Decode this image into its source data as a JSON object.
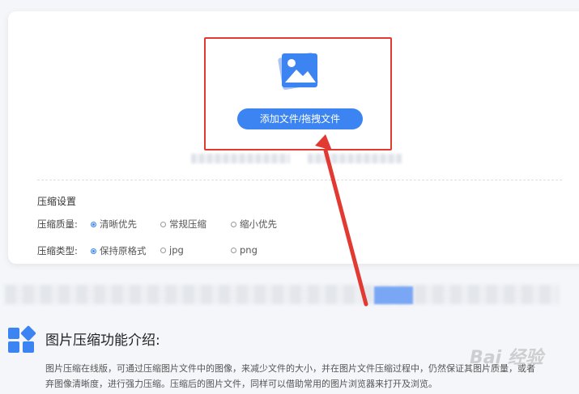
{
  "upload": {
    "add_button_label": "添加文件/拖拽文件"
  },
  "settings": {
    "title": "压缩设置",
    "quality": {
      "label": "压缩质量:",
      "options": [
        "清晰优先",
        "常规压缩",
        "缩小优先"
      ],
      "selected": "清晰优先"
    },
    "type": {
      "label": "压缩类型:",
      "options": [
        "保持原格式",
        "jpg",
        "png"
      ],
      "selected": "保持原格式"
    }
  },
  "intro": {
    "title": "图片压缩功能介绍:",
    "line1": "图片压缩在线版，可通过压缩图片文件中的图像，来减少文件的大小，并在图片文件压缩过程中，仍然保证其图片质量，或者",
    "line2": "弃图像清晰度，进行强力压缩。压缩后的图片文件，同样可以借助常用的图片浏览器来打开及浏览。"
  },
  "watermark": "Bai 经验",
  "colors": {
    "accent": "#3b84f2",
    "highlight_border": "#e23a32"
  }
}
